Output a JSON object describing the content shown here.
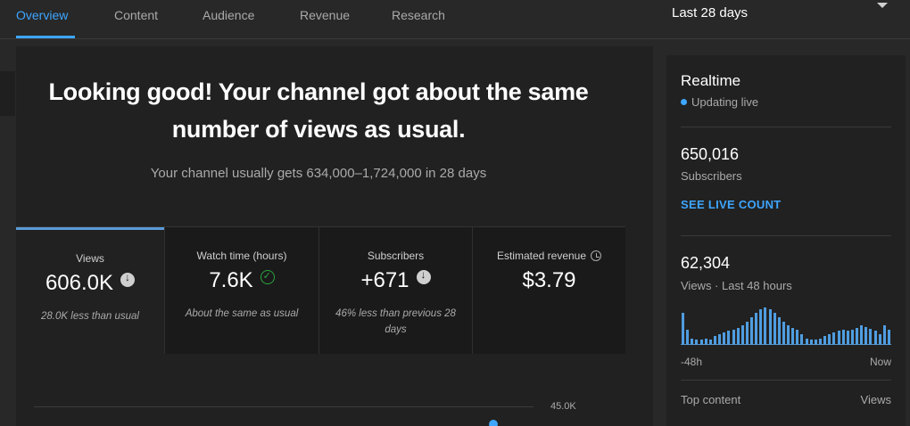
{
  "tabs": [
    {
      "label": "Overview"
    },
    {
      "label": "Content"
    },
    {
      "label": "Audience"
    },
    {
      "label": "Revenue"
    },
    {
      "label": "Research"
    }
  ],
  "active_tab": "Overview",
  "period": "Last 28 days",
  "headline": {
    "line1": "Looking good! Your channel got about the same",
    "line2": "number of views as usual."
  },
  "subtext": "Your channel usually gets 634,000–1,724,000 in 28 days",
  "metrics": [
    {
      "label": "Views",
      "value": "606.0K",
      "note": "28.0K less than usual",
      "icon": "arrow-down-icon"
    },
    {
      "label": "Watch time (hours)",
      "value": "7.6K",
      "note": "About the same as usual",
      "icon": "check-icon"
    },
    {
      "label": "Subscribers",
      "value": "+671",
      "note": "46% less than previous 28 days",
      "icon": "arrow-down-icon"
    },
    {
      "label": "Estimated revenue",
      "value": "$3.79",
      "note": "",
      "icon": "clock-icon"
    }
  ],
  "chart": {
    "y_max_label": "45.0K"
  },
  "realtime": {
    "title": "Realtime",
    "status": "Updating live",
    "subscribers": "650,016",
    "subscribers_label": "Subscribers",
    "live_count_link": "SEE LIVE COUNT",
    "views": "62,304",
    "views_label": "Views · Last 48 hours",
    "hourly_views": [
      30,
      14,
      6,
      5,
      5,
      6,
      5,
      8,
      10,
      12,
      13,
      14,
      16,
      18,
      22,
      26,
      30,
      33,
      35,
      33,
      30,
      26,
      22,
      18,
      16,
      14,
      10,
      6,
      5,
      5,
      6,
      8,
      10,
      12,
      13,
      14,
      13,
      14,
      16,
      18,
      17,
      15,
      13,
      10,
      18,
      14
    ],
    "start_label": "-48h",
    "end_label": "Now",
    "top_content_label": "Top content",
    "top_content_views_label": "Views"
  },
  "colors": {
    "accent": "#3ea6ff",
    "success": "#2ba640",
    "background": "#282828",
    "card": "#212121"
  }
}
